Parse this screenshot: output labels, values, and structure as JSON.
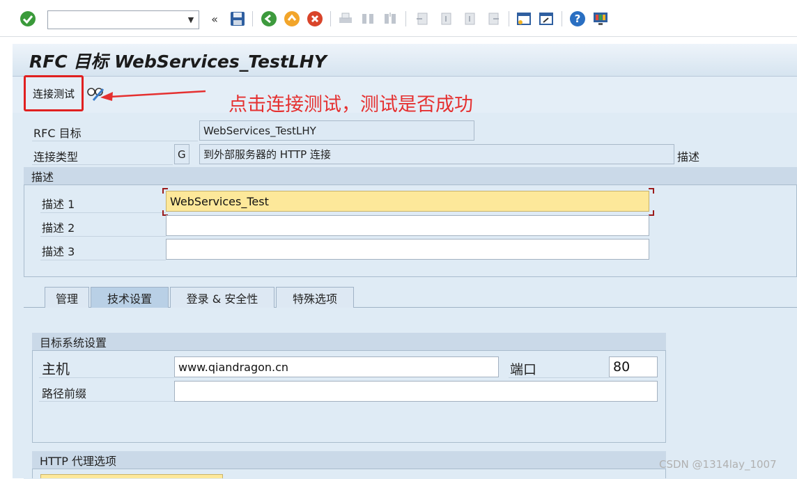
{
  "toolbar": {
    "command_value": "",
    "icons": [
      "check-icon",
      "dropdown-icon",
      "collapse-icon",
      "save-icon",
      "back-icon",
      "exit-icon",
      "cancel-icon",
      "print-icon",
      "find-icon",
      "find-next-icon",
      "first-page-icon",
      "previous-page-icon",
      "next-page-icon",
      "last-page-icon",
      "create-session-icon",
      "shortcut-icon",
      "help-icon",
      "customize-layout-icon"
    ],
    "colors": {
      "check": "#3a9a3a",
      "back": "#3d9a3d",
      "exit": "#f2a52a",
      "cancel": "#d9442a",
      "help": "#2a6fc2"
    }
  },
  "title": "RFC 目标 WebServices_TestLHY",
  "app_toolbar": {
    "connection_test": "连接测试",
    "glasses_icon": "display-change-icon"
  },
  "annotation": {
    "text": "点击连接测试，测试是否成功",
    "color": "#e53030"
  },
  "header_fields": {
    "rfc_target_label": "RFC 目标",
    "rfc_target_value": "WebServices_TestLHY",
    "conn_type_label": "连接类型",
    "conn_type_code": "G",
    "conn_type_desc": "到外部服务器的 HTTP 连接",
    "desc_link": "描述"
  },
  "description_group": {
    "title": "描述",
    "rows": [
      {
        "label": "描述 1",
        "value": "WebServices_Test"
      },
      {
        "label": "描述 2",
        "value": ""
      },
      {
        "label": "描述 3",
        "value": ""
      }
    ]
  },
  "tabs": [
    {
      "label": "管理",
      "active": false
    },
    {
      "label": "技术设置",
      "active": true
    },
    {
      "label": "登录 & 安全性",
      "active": false
    },
    {
      "label": "特殊选项",
      "active": false
    }
  ],
  "target_system": {
    "title": "目标系统设置",
    "host_label": "主机",
    "host_value": "www.qiandragon.cn",
    "port_label": "端口",
    "port_value": "80",
    "path_prefix_label": "路径前缀",
    "path_prefix_value": ""
  },
  "http_proxy": {
    "title": "HTTP 代理选项"
  },
  "watermark": "CSDN @1314lay_1007"
}
